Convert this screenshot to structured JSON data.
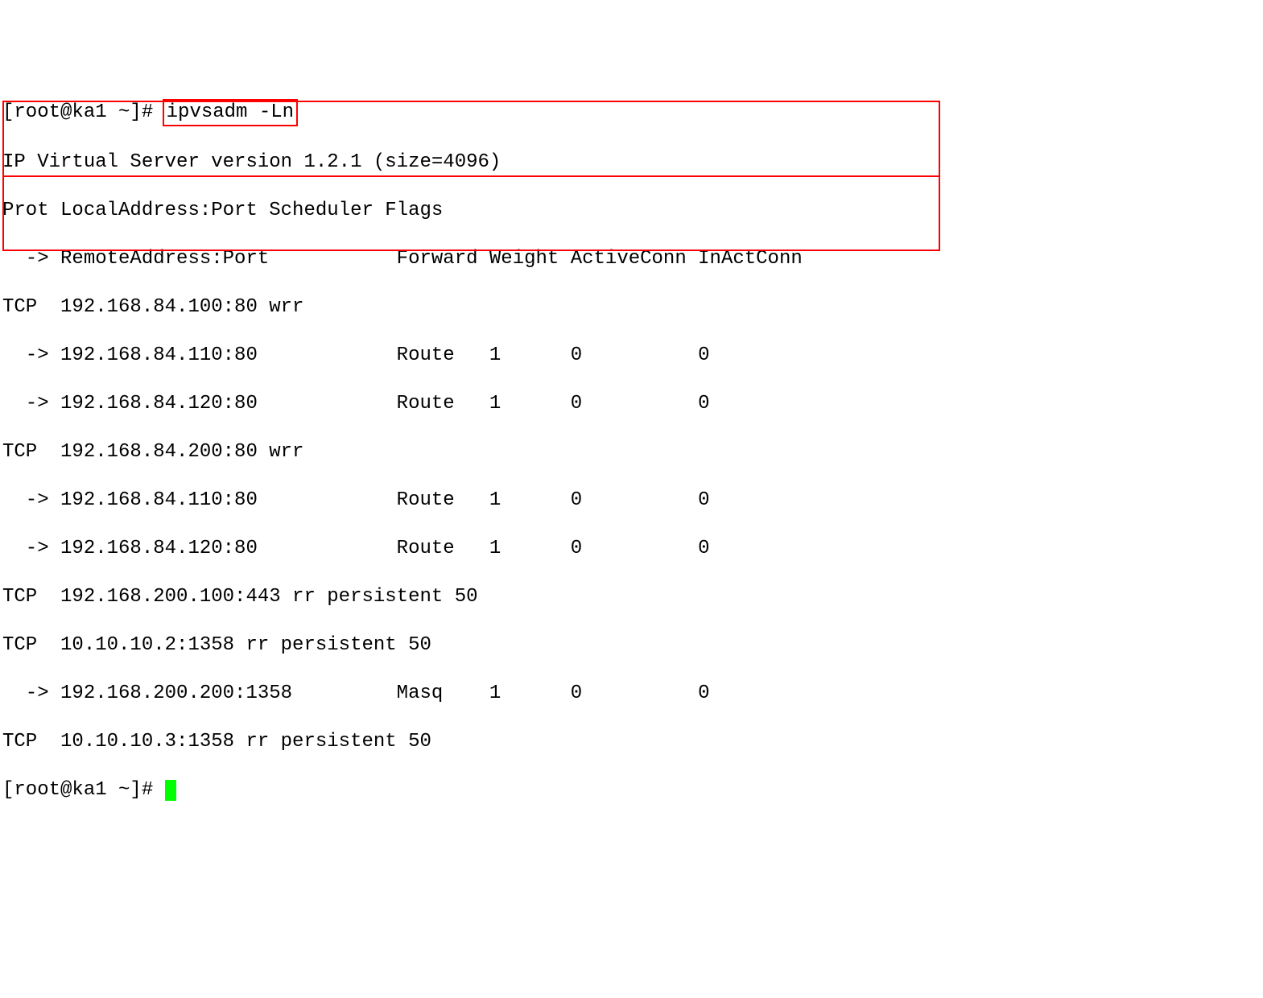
{
  "prompt1_prefix": "[root@ka1 ~]# ",
  "command": "ipvsadm -Ln",
  "header_line1": "IP Virtual Server version 1.2.1 (size=4096)",
  "header_line2": "Prot LocalAddress:Port Scheduler Flags",
  "header_line3": "  -> RemoteAddress:Port           Forward Weight ActiveConn InActConn",
  "svc1": "TCP  192.168.84.100:80 wrr",
  "svc1r1": "  -> 192.168.84.110:80            Route   1      0          0         ",
  "svc1r2": "  -> 192.168.84.120:80            Route   1      0          0         ",
  "svc2": "TCP  192.168.84.200:80 wrr",
  "svc2r1": "  -> 192.168.84.110:80            Route   1      0          0         ",
  "svc2r2": "  -> 192.168.84.120:80            Route   1      0          0         ",
  "svc3": "TCP  192.168.200.100:443 rr persistent 50",
  "svc4": "TCP  10.10.10.2:1358 rr persistent 50",
  "svc4r1": "  -> 192.168.200.200:1358         Masq    1      0          0         ",
  "svc5": "TCP  10.10.10.3:1358 rr persistent 50",
  "prompt2": "[root@ka1 ~]# "
}
